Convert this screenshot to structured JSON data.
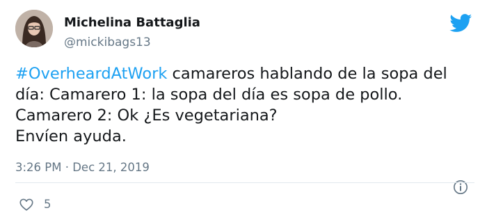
{
  "author": {
    "display_name": "Michelina Battaglia",
    "handle": "@mickibags13",
    "avatar_icon": "profile-photo"
  },
  "tweet": {
    "hashtag": "#OverheardAtWork",
    "lines": [
      " camareros hablando de la sopa del",
      "día: Camarero 1: la sopa del día es sopa de pollo.",
      "Camarero 2: Ok ¿Es vegetariana?",
      "Envíen ayuda."
    ],
    "timestamp": "3:26 PM · Dec 21, 2019"
  },
  "actions": {
    "like_count": "5"
  },
  "colors": {
    "hashtag": "#1da1f2",
    "brand": "#1da1f2",
    "secondary_text": "#657786",
    "primary_text": "#14171a",
    "divider": "#e1e8ed"
  },
  "icons": {
    "brand": "twitter-bird-icon",
    "info": "info-icon",
    "like": "heart-icon"
  }
}
